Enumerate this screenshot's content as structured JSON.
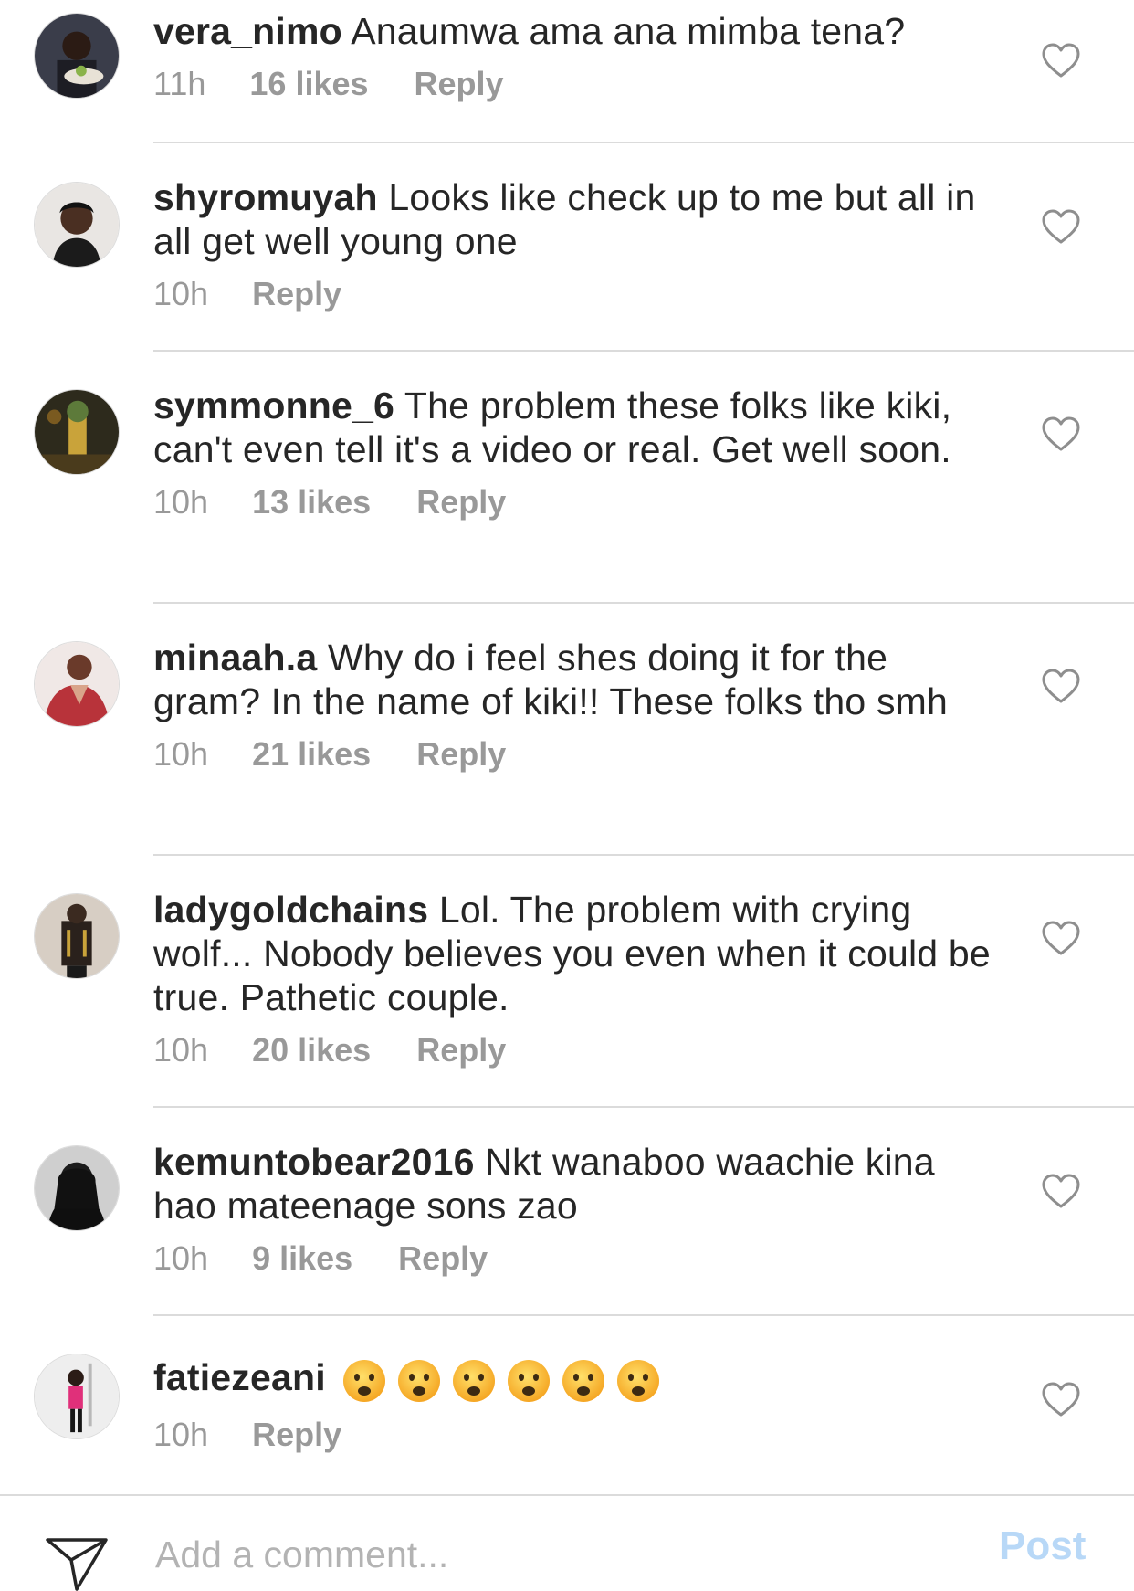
{
  "comments": [
    {
      "username": "vera_nimo",
      "text": "Anaumwa ama ana mimba tena?",
      "time": "11h",
      "likes": "16 likes",
      "reply": "Reply",
      "avatar_icon": "avatar-photo"
    },
    {
      "username": "shyromuyah",
      "text": "Looks like check up to me but all in all get well young one",
      "time": "10h",
      "likes": "",
      "reply": "Reply",
      "avatar_icon": "avatar-photo"
    },
    {
      "username": "symmonne_6",
      "text": "The problem these folks like kiki, can't even tell it's a video or real. Get well soon.",
      "time": "10h",
      "likes": "13 likes",
      "reply": "Reply",
      "avatar_icon": "avatar-photo"
    },
    {
      "username": "minaah.a",
      "text": "Why do i feel shes doing it for the gram? In the name of kiki!! These folks tho smh",
      "time": "10h",
      "likes": "21 likes",
      "reply": "Reply",
      "avatar_icon": "avatar-photo"
    },
    {
      "username": "ladygoldchains",
      "text": "Lol. The problem with crying wolf... Nobody believes you even when it could be true. Pathetic couple.",
      "time": "10h",
      "likes": "20 likes",
      "reply": "Reply",
      "avatar_icon": "avatar-photo"
    },
    {
      "username": "kemuntobear2016",
      "text": "Nkt wanaboo waachie kina hao mateenage sons zao",
      "time": "10h",
      "likes": "9 likes",
      "reply": "Reply",
      "avatar_icon": "avatar-photo"
    },
    {
      "username": "fatiezeani",
      "text": "",
      "emoji": "frowning-face",
      "emoji_count": 6,
      "time": "10h",
      "likes": "",
      "reply": "Reply",
      "avatar_icon": "avatar-photo"
    }
  ],
  "composer": {
    "placeholder": "Add a comment...",
    "post_label": "Post",
    "send_icon": "paper-plane-icon"
  },
  "colors": {
    "text": "#262626",
    "meta": "#999999",
    "divider": "#dbdbdb",
    "post_disabled": "#b8d8f7"
  }
}
